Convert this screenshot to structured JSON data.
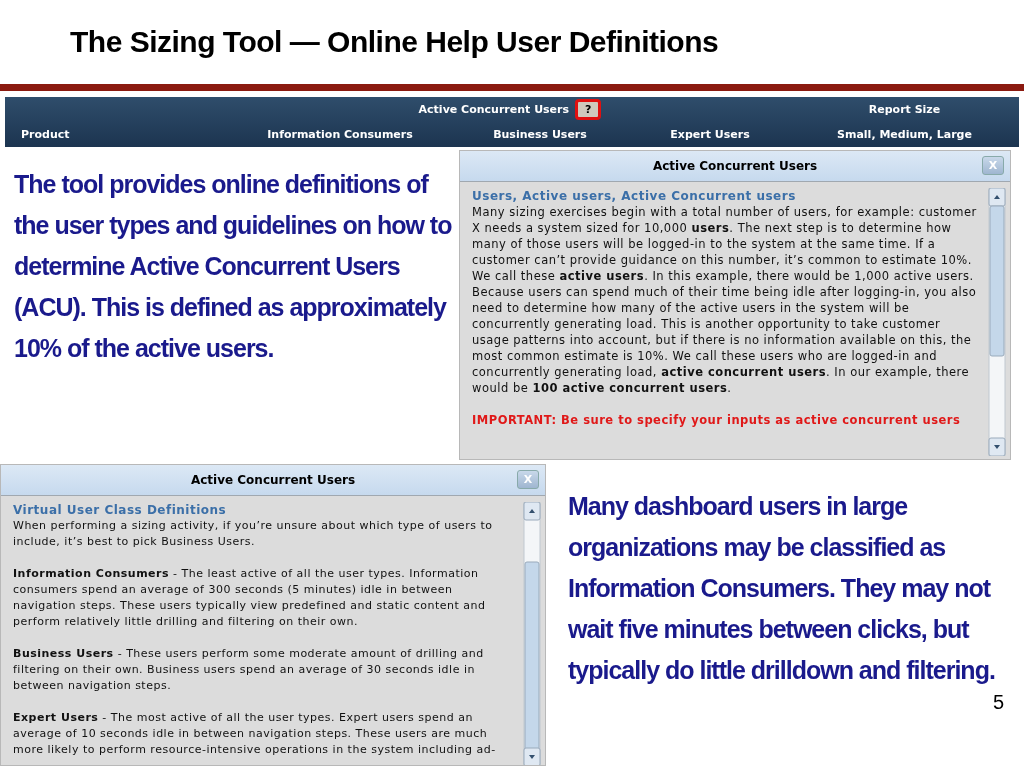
{
  "slide_title": "The Sizing Tool — Online Help User Definitions",
  "grid_header": {
    "groups": [
      {
        "label": "Active Concurrent Users",
        "help": "?",
        "highlighted": true
      },
      {
        "label": "Report Size"
      }
    ],
    "columns": [
      "Product",
      "Information Consumers",
      "Business Users",
      "Expert Users",
      "Small, Medium, Large"
    ]
  },
  "intro_text": "The tool provides online definitions of the user types and guidelines on how to determine Active Concurrent Users (ACU). This is defined as approximately 10% of the active users.",
  "dialogs": [
    {
      "title": "Active Concurrent Users",
      "close": "X",
      "heading": "Users, Active users, Active Concurrent users",
      "paragraphs": [
        {
          "kind": "text",
          "text": "Many sizing exercises begin with a total number of users, for example: customer X needs a system sized for 10,000 **users**.  The next step is to determine how many of those users will be logged-in to the system at the same time.  If a customer can’t provide guidance on this number, it’s common to estimate 10%.  We call these **active users**.  In this example, there would be 1,000 active users.  Because users can spend much of their time being idle after logging-in, you also need to determine how many of the active users in the system will be concurrently generating load.  This is another opportunity to take customer usage patterns into account, but if there is no information available on this, the most common estimate is 10%.  We call these users who are logged-in and concurrently generating load, **active concurrent users**.  In our example, there would be **100 active concurrent users**."
        },
        {
          "kind": "warning",
          "text": "IMPORTANT: Be sure to specify your inputs as active concurrent users"
        }
      ]
    },
    {
      "title": "Active Concurrent Users",
      "close": "X",
      "heading": "Virtual User Class Definitions",
      "paragraphs": [
        {
          "kind": "text",
          "text": "When performing a sizing activity, if you’re unsure about which type of users to include, it’s best to pick Business Users."
        },
        {
          "kind": "text",
          "text": "**Information Consumers** - The least active of all the user types. Information consumers spend an average of 300 seconds (5 minutes) idle in between navigation steps. These users typically view predefined and static content and perform relatively little drilling and filtering on their own."
        },
        {
          "kind": "text",
          "text": "**Business Users** - These users perform some moderate amount of drilling and filtering on their own. Business users spend an average of 30 seconds idle in between navigation steps."
        },
        {
          "kind": "text",
          "text": "**Expert Users** - The most active of all the user types. Expert users spend an average of 10 seconds idle in between navigation steps. These users are much more likely to perform resource-intensive operations in the system including ad-"
        }
      ]
    }
  ],
  "note_text": "Many dashboard users in large organizations may be classified as Information Consumers. They may not wait five minutes between clicks, but typically do little drilldown and filtering.",
  "page_number": "5"
}
